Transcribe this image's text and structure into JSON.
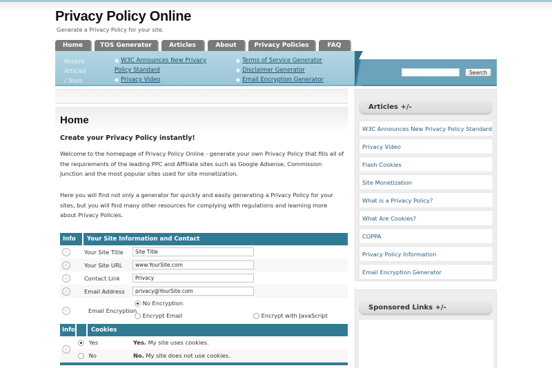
{
  "site": {
    "title": "Privacy Policy Online",
    "tagline": "Generate a Privacy Policy for your site."
  },
  "nav": {
    "tabs": [
      {
        "label": "Home"
      },
      {
        "label": "TOS Generator"
      },
      {
        "label": "Articles"
      },
      {
        "label": "About"
      },
      {
        "label": "Privacy Policies"
      },
      {
        "label": "FAQ"
      }
    ]
  },
  "subbar": {
    "label_line1": "Recent Articles",
    "label_line2": "/ Tools",
    "col1": [
      {
        "label": "W3C Announces New Privacy Policy Standard"
      },
      {
        "label": "Privacy Video"
      }
    ],
    "col2": [
      {
        "label": "Terms of Service Generator"
      },
      {
        "label": "Disclaimer Generator"
      },
      {
        "label": "Email Encryption Generator"
      }
    ]
  },
  "search": {
    "value": "",
    "button_label": "Search"
  },
  "main": {
    "page_title": "Home",
    "subheading": "Create your Privacy Policy instantly!",
    "para1": "Welcome to the homepage of Privacy Policy Online - generate your own Privacy Policy that fills all of the requirements of the leading PPC and Affiliate sites such as Google Adsense, Commission Junction and the most popular sites used for site monetization.",
    "para2": "Here you will find not only a generator for quickly and easily generating a Privacy Policy for your sites, but you will find many other resources for complying with regulations and learning more about Privacy Policies."
  },
  "form": {
    "section1": {
      "info_label": "Info",
      "title": "Your Site Information and Contact",
      "fields": [
        {
          "label": "Your Site Title",
          "value": "Site Title"
        },
        {
          "label": "Your Site URL",
          "value": "www.YourSite.com"
        },
        {
          "label": "Contact Link",
          "value": "Privacy"
        },
        {
          "label": "Email Address",
          "value": "privacy@YourSite.com"
        }
      ],
      "encryption": {
        "label": "Email Encryption",
        "options": [
          {
            "label": "No Encryption",
            "selected": true
          },
          {
            "label": "Encrypt Email",
            "selected": false
          },
          {
            "label": "Encrypt with JavaScript",
            "selected": false
          }
        ]
      }
    },
    "section2": {
      "info_label": "Info",
      "title": "Cookies",
      "options": [
        {
          "label": "Yes",
          "bold": "Yes.",
          "desc": " My site uses cookies.",
          "selected": true
        },
        {
          "label": "No",
          "bold": "No.",
          "desc": " My site does not use cookies.",
          "selected": false
        }
      ]
    }
  },
  "sidebar": {
    "articles_header": "Articles +/-",
    "articles": [
      {
        "label": "W3C Announces New Privacy Policy Standard"
      },
      {
        "label": "Privacy Video"
      },
      {
        "label": "Flash Cookies"
      },
      {
        "label": "Site Monetization"
      },
      {
        "label": "What is a Privacy Policy?"
      },
      {
        "label": "What Are Cookies?"
      },
      {
        "label": "COPPA"
      },
      {
        "label": "Privacy Policy Information"
      },
      {
        "label": "Email Encryption Generator"
      }
    ],
    "sponsored_header": "Sponsored Links +/-"
  },
  "colors": {
    "accent": "#327a94",
    "nav_tab": "#7a7a7a",
    "subbar": "#a8cfdf",
    "link": "#2a5d7a"
  }
}
